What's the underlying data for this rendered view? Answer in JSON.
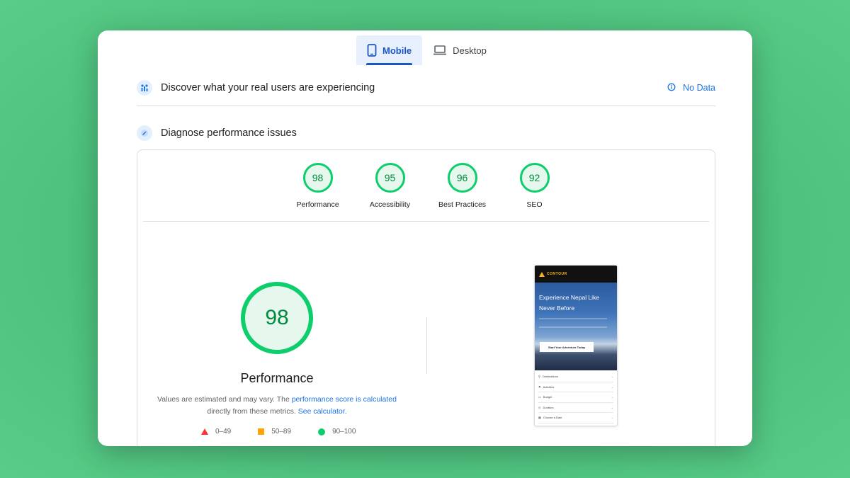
{
  "tabs": [
    {
      "label": "Mobile",
      "icon": "smartphone-icon",
      "active": true
    },
    {
      "label": "Desktop",
      "icon": "laptop-icon",
      "active": false
    }
  ],
  "field_data": {
    "title": "Discover what your real users are experiencing",
    "status": "No Data"
  },
  "diagnose": {
    "title": "Diagnose performance issues"
  },
  "scores": [
    {
      "label": "Performance",
      "value": "98"
    },
    {
      "label": "Accessibility",
      "value": "95"
    },
    {
      "label": "Best Practices",
      "value": "96"
    },
    {
      "label": "SEO",
      "value": "92"
    }
  ],
  "performance": {
    "score": "98",
    "title": "Performance",
    "note_before": "Values are estimated and may vary. The ",
    "note_link1": "performance score is calculated",
    "note_middle": " directly from these metrics. ",
    "note_link2": "See calculator.",
    "legend": [
      {
        "range": "0–49",
        "color": "#ff3333",
        "shape": "triangle"
      },
      {
        "range": "50–89",
        "color": "#ffa400",
        "shape": "square"
      },
      {
        "range": "90–100",
        "color": "#0cce6b",
        "shape": "circle"
      }
    ]
  },
  "preview": {
    "logo": "CONTOUR",
    "logo_sub": "EXPEDITIONS",
    "headline": "Experience Nepal Like Never Before",
    "cta": "Start Your Adventure Today",
    "fields": [
      "Destinations",
      "Activities",
      "Budget",
      "Duration",
      "Choose a Date"
    ]
  },
  "colors": {
    "pass": "#0cce6b",
    "accent": "#1a73e8",
    "background": "#4fc783"
  }
}
